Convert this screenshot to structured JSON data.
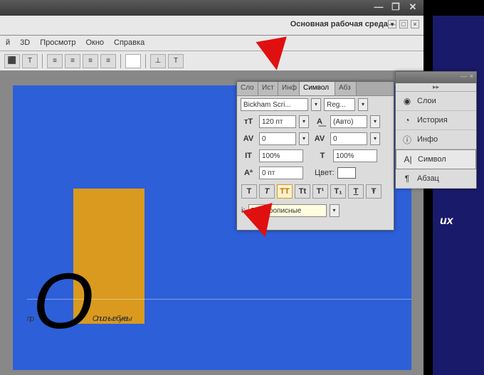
{
  "titlebar": {
    "min": "—",
    "max": "❐",
    "close": "✕"
  },
  "workspace": {
    "label": "Основная рабочая среда",
    "min": "—",
    "rest": "□",
    "close": "×"
  },
  "menu": {
    "i1": "й",
    "i2": "3D",
    "i3": "Просмотр",
    "i4": "Окно",
    "i5": "Справка"
  },
  "options": {
    "b1": "⬛",
    "b2": "T",
    "al1": "≡",
    "al2": "≡",
    "al3": "≡",
    "al4": "≡",
    "sw": " ",
    "sp1": "⊥",
    "sp2": "T"
  },
  "canvas": {
    "pre": "пр",
    "bigO": "О",
    "rest": "Описные буквы"
  },
  "char_panel": {
    "tabs": {
      "t1": "Сло",
      "t2": "Ист",
      "t3": "Инф",
      "t4": "Символ",
      "t5": "Абз"
    },
    "font_family": "Bickham Scri...",
    "font_style": "Reg...",
    "size_icon": "тТ",
    "size": "120 пт",
    "leading_icon": "A͟",
    "leading": "(Авто)",
    "kern_icon": "AV",
    "kern": "0",
    "track_icon": "AV",
    "track": "0",
    "vscale_icon": "IT",
    "vscale": "100%",
    "hscale_icon": "T",
    "hscale": "100%",
    "baseline_icon": "Aª",
    "baseline": "0 пт",
    "color_label": "Цвет:",
    "tt": {
      "b1": "T",
      "b2": "T",
      "b3": "TT",
      "b4": "Tt",
      "b5": "T¹",
      "b6": "T₁",
      "b7": "T",
      "b8": "Ŧ"
    },
    "lang_prefix": "і:",
    "lang": "Все прописные"
  },
  "side_panel": {
    "arrow": "▸▸",
    "items": {
      "i1": {
        "icon": "◉",
        "label": "Слои"
      },
      "i2": {
        "icon": "◔",
        "label": "История"
      },
      "i3": {
        "icon": "ⓘ",
        "label": "Инфо"
      },
      "i4": {
        "icon": "A|",
        "label": "Символ"
      },
      "i5": {
        "icon": "¶",
        "label": "Абзац"
      }
    }
  },
  "dark": {
    "txt": "их"
  }
}
